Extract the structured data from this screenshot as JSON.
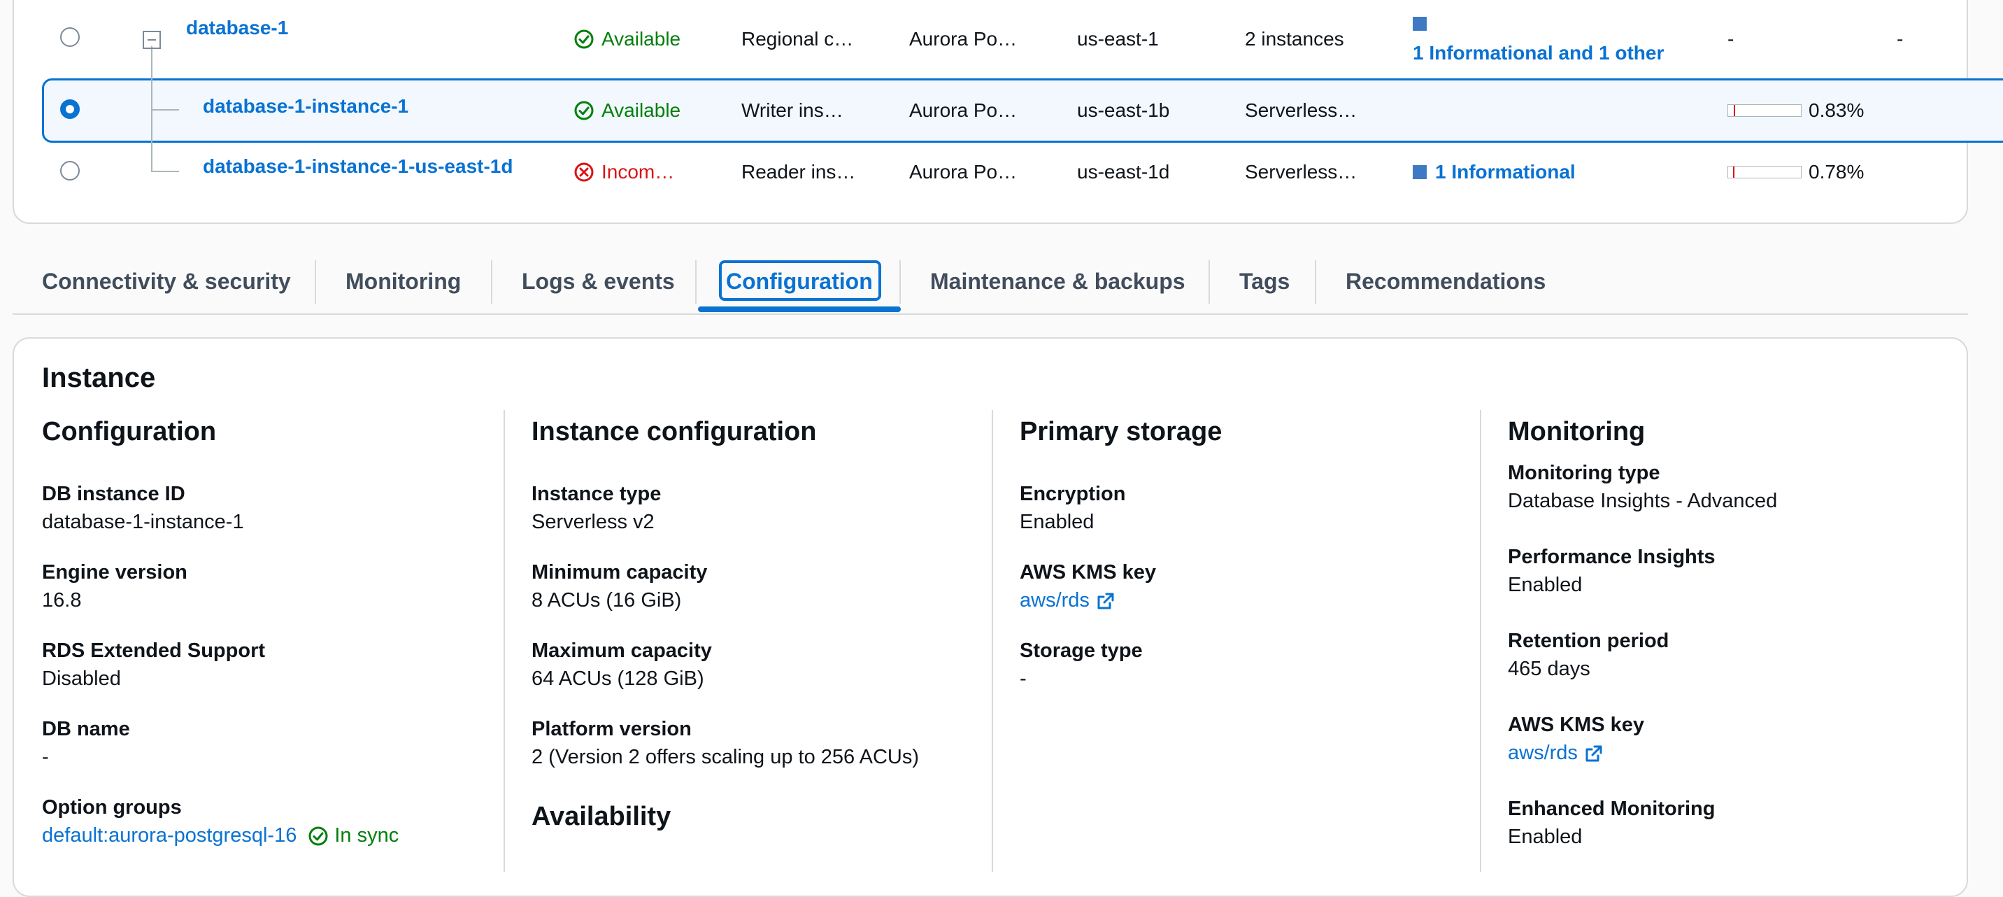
{
  "table": {
    "rows": [
      {
        "name": "database-1",
        "status": "Available",
        "role": "Regional c…",
        "engine": "Aurora Po…",
        "region": "us-east-1",
        "size": "2 instances",
        "recommendations": "1 Informational and 1 other",
        "cpu": "-",
        "last": "-"
      },
      {
        "name": "database-1-instance-1",
        "status": "Available",
        "role": "Writer ins…",
        "engine": "Aurora Po…",
        "region": "us-east-1b",
        "size": "Serverless…",
        "recommendations": "",
        "cpu": "0.83%",
        "cpu_fraction": 0.0083
      },
      {
        "name": "database-1-instance-1-us-east-1d",
        "status": "Incom…",
        "role": "Reader ins…",
        "engine": "Aurora Po…",
        "region": "us-east-1d",
        "size": "Serverless…",
        "recommendations": "1 Informational",
        "cpu": "0.78%",
        "cpu_fraction": 0.0078
      }
    ]
  },
  "tabs": [
    {
      "label": "Connectivity & security"
    },
    {
      "label": "Monitoring"
    },
    {
      "label": "Logs & events"
    },
    {
      "label": "Configuration",
      "active": true
    },
    {
      "label": "Maintenance & backups"
    },
    {
      "label": "Tags"
    },
    {
      "label": "Recommendations"
    }
  ],
  "instance": {
    "title": "Instance",
    "configuration": {
      "heading": "Configuration",
      "db_instance_id": {
        "label": "DB instance ID",
        "value": "database-1-instance-1"
      },
      "engine_version": {
        "label": "Engine version",
        "value": "16.8"
      },
      "extended_support": {
        "label": "RDS Extended Support",
        "value": "Disabled"
      },
      "db_name": {
        "label": "DB name",
        "value": "-"
      },
      "option_groups": {
        "label": "Option groups",
        "value": "default:aurora-postgresql-16",
        "status": "In sync"
      }
    },
    "instance_configuration": {
      "heading": "Instance configuration",
      "instance_type": {
        "label": "Instance type",
        "value": "Serverless v2"
      },
      "min_capacity": {
        "label": "Minimum capacity",
        "value": "8 ACUs (16 GiB)"
      },
      "max_capacity": {
        "label": "Maximum capacity",
        "value": "64 ACUs (128 GiB)"
      },
      "platform_version": {
        "label": "Platform version",
        "value": "2 (Version 2 offers scaling up to 256 ACUs)"
      },
      "availability_heading": "Availability"
    },
    "primary_storage": {
      "heading": "Primary storage",
      "encryption": {
        "label": "Encryption",
        "value": "Enabled"
      },
      "kms_key": {
        "label": "AWS KMS key",
        "value": "aws/rds"
      },
      "storage_type": {
        "label": "Storage type",
        "value": "-"
      }
    },
    "monitoring": {
      "heading": "Monitoring",
      "monitoring_type": {
        "label": "Monitoring type",
        "value": "Database Insights - Advanced"
      },
      "performance_insights": {
        "label": "Performance Insights",
        "value": "Enabled"
      },
      "retention_period": {
        "label": "Retention period",
        "value": "465 days"
      },
      "kms_key": {
        "label": "AWS KMS key",
        "value": "aws/rds"
      },
      "enhanced_monitoring": {
        "label": "Enhanced Monitoring",
        "value": "Enabled"
      }
    }
  },
  "colors": {
    "link": "#0972d3",
    "success": "#037f0c",
    "error": "#d91515",
    "info_square": "#3d7ac3"
  }
}
